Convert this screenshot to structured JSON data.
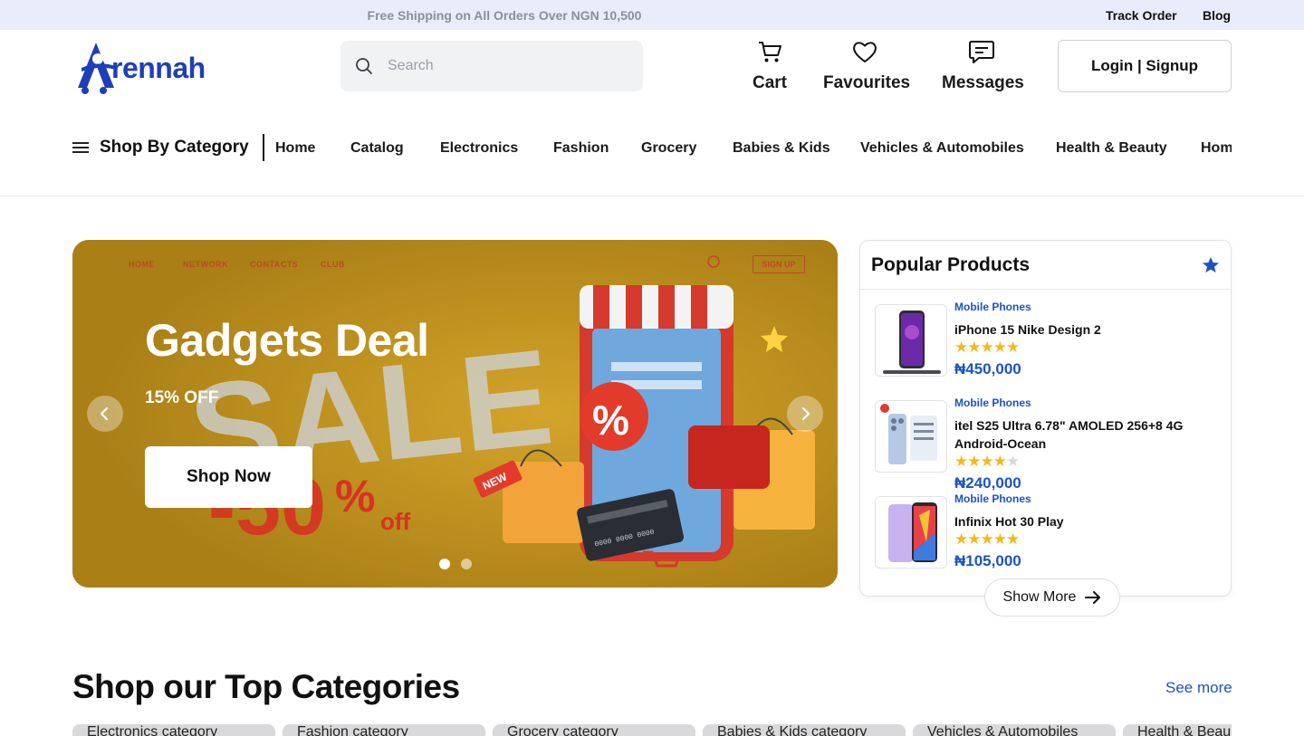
{
  "topbar": {
    "promo": "Free Shipping on All Orders Over NGN 10,500",
    "track_order": "Track Order",
    "blog": "Blog"
  },
  "brand": {
    "logo_text": "rennah",
    "color": "#1f3fb8"
  },
  "search": {
    "placeholder": "Search",
    "value": ""
  },
  "header_actions": {
    "cart": {
      "label": "Cart",
      "icon": "cart-icon"
    },
    "favourites": {
      "label": "Favourites",
      "icon": "heart-icon"
    },
    "messages": {
      "label": "Messages",
      "icon": "chat-icon"
    },
    "login": "Login | Signup"
  },
  "nav": {
    "category_button": "Shop By Category",
    "links": [
      "Home",
      "Catalog",
      "Electronics",
      "Fashion",
      "Grocery",
      "Babies & Kids",
      "Vehicles & Automobiles",
      "Health & Beauty",
      "Hom"
    ]
  },
  "hero": {
    "mini_nav": [
      "HOME",
      "NETWORK",
      "CONTACTS",
      "CLUB"
    ],
    "mini_signup": "SIGN UP",
    "backdrop_sale": "SALE",
    "backdrop_percent": "-50",
    "backdrop_off": "off",
    "backdrop_tag": "NEW",
    "headline": "Gadgets Deal",
    "offer": "15% OFF",
    "cta": "Shop Now",
    "slide_count": 2,
    "active_slide": 1,
    "accent": "#b58b1d"
  },
  "popular": {
    "title": "Popular Products",
    "items": [
      {
        "category": "Mobile Phones",
        "name": "iPhone 15 Nike Design 2",
        "rating": 5,
        "price": "₦450,000"
      },
      {
        "category": "Mobile Phones",
        "name": "itel S25 Ultra 6.78\" AMOLED 256+8 4G Android-Ocean",
        "rating": 4,
        "price": "₦240,000"
      },
      {
        "category": "Mobile Phones",
        "name": "Infinix Hot 30 Play",
        "rating": 5,
        "price": "₦105,000"
      }
    ],
    "show_more": "Show More",
    "accent": "#1b53c6"
  },
  "categories": {
    "title": "Shop our Top Categories",
    "see_more": "See more",
    "cards": [
      "Electronics category",
      "Fashion category",
      "Grocery category",
      "Babies & Kids category",
      "Vehicles & Automobiles",
      "Health & Beau"
    ]
  }
}
